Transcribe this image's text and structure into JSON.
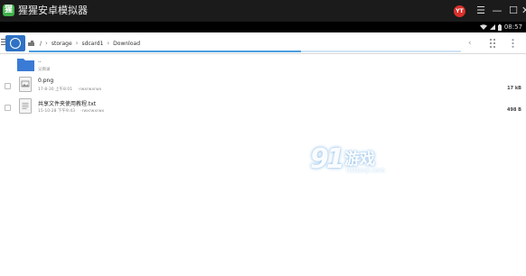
{
  "window": {
    "title": "猩猩安卓模拟器",
    "logo_text": "猩",
    "avatar_text": "YT",
    "controls": {
      "menu": "☰",
      "minimize": "—",
      "maximize": "☐",
      "close": "✕"
    }
  },
  "statusbar": {
    "time": "08:57"
  },
  "toolbar": {
    "breadcrumb": [
      "/",
      "storage",
      "sdcard1",
      "Download"
    ],
    "progress": 0.63
  },
  "files": [
    {
      "name": "..",
      "meta": [
        "父目录"
      ],
      "size": "",
      "type": "folder"
    },
    {
      "name": "0.png",
      "meta": [
        "17-8-30 上午8:01",
        "-rwxrwxrwx"
      ],
      "size": "17 kB",
      "type": "image"
    },
    {
      "name": "共享文件夹使用教程.txt",
      "meta": [
        "15-10-28 下午9:43",
        "-rwxrwxrwx"
      ],
      "size": "498 B",
      "type": "text"
    }
  ],
  "watermark": {
    "number": "91",
    "cn": "游戏",
    "url": "91danji.com"
  },
  "colors": {
    "accent": "#2f72c4",
    "titlebar": "#1b1b1b",
    "folder": "#3a7bd5"
  }
}
